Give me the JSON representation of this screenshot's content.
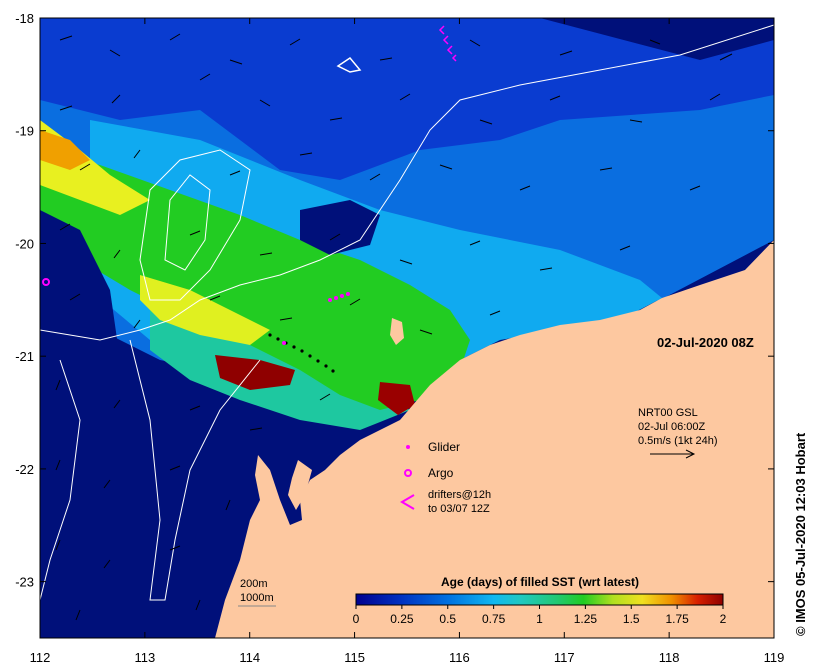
{
  "map": {
    "timestamp": "02-Jul-2020 08Z",
    "credit": "©  IMOS 05-Jul-2020 12:03 Hobart",
    "lon_ticks": [
      "112",
      "113",
      "114",
      "115",
      "116",
      "117",
      "118",
      "119"
    ],
    "lat_ticks": [
      "-18",
      "-19",
      "-20",
      "-21",
      "-22",
      "-23"
    ],
    "lon_range": [
      112,
      119
    ],
    "lat_range": [
      -23.5,
      -18
    ],
    "current_legend": {
      "line1": "NRT00 GSL",
      "line2": "02-Jul 06:00Z",
      "line3": "0.5m/s (1kt 24h)"
    },
    "symbol_legend": {
      "glider": "Glider",
      "argo": "Argo",
      "drifters_line1": "drifters@12h",
      "drifters_line2": "to 03/07 12Z"
    },
    "isobaths": {
      "label_200": "200m",
      "label_1000": "1000m"
    },
    "colorbar": {
      "title": "Age (days) of filled SST (wrt latest)",
      "tick_labels": [
        "0",
        "0.25",
        "0.5",
        "0.75",
        "1",
        "1.25",
        "1.5",
        "1.75",
        "2"
      ],
      "range": [
        0,
        2
      ]
    },
    "colors": {
      "ocean_deep": "#00107a",
      "age_0": "#00008f",
      "age_025": "#0044c8",
      "age_05": "#0aa8f0",
      "age_075": "#20c8a0",
      "age_1": "#22cc22",
      "age_125": "#e8f020",
      "age_15": "#f0a000",
      "age_2": "#8f0000",
      "land": "#fdc8a0",
      "markers": "#ff00ff"
    }
  }
}
